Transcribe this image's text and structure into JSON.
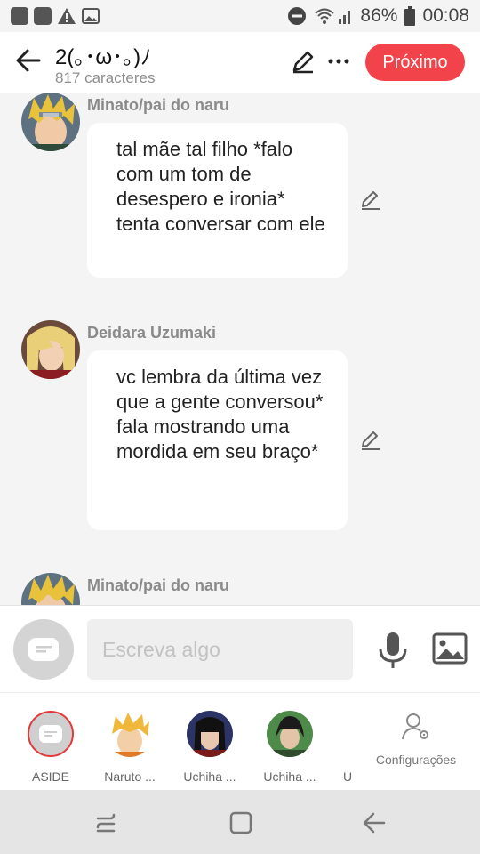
{
  "status": {
    "battery": "86%",
    "time": "00:08"
  },
  "header": {
    "title": "2(｡･ω･｡)ﾉ",
    "char_count": "817 caracteres",
    "next_label": "Próximo"
  },
  "messages": [
    {
      "name": "Minato/pai do naru",
      "text": "tal mãe tal filho *falo com um tom de desespero e ironia* tenta conversar com ele"
    },
    {
      "name": "Deidara Uzumaki",
      "text": "vc lembra da última vez que a gente conversou* fala mostrando uma mordida em seu braço*"
    },
    {
      "name": "Minato/pai do naru",
      "text": ""
    }
  ],
  "composer": {
    "placeholder": "Escreva algo"
  },
  "characters": [
    {
      "label": "ASIDE"
    },
    {
      "label": "Naruto ..."
    },
    {
      "label": "Uchiha ..."
    },
    {
      "label": "Uchiha ..."
    },
    {
      "label": "U"
    }
  ],
  "config_label": "Configurações",
  "colors": {
    "accent": "#f2424a",
    "name": "#8a8a8a"
  }
}
